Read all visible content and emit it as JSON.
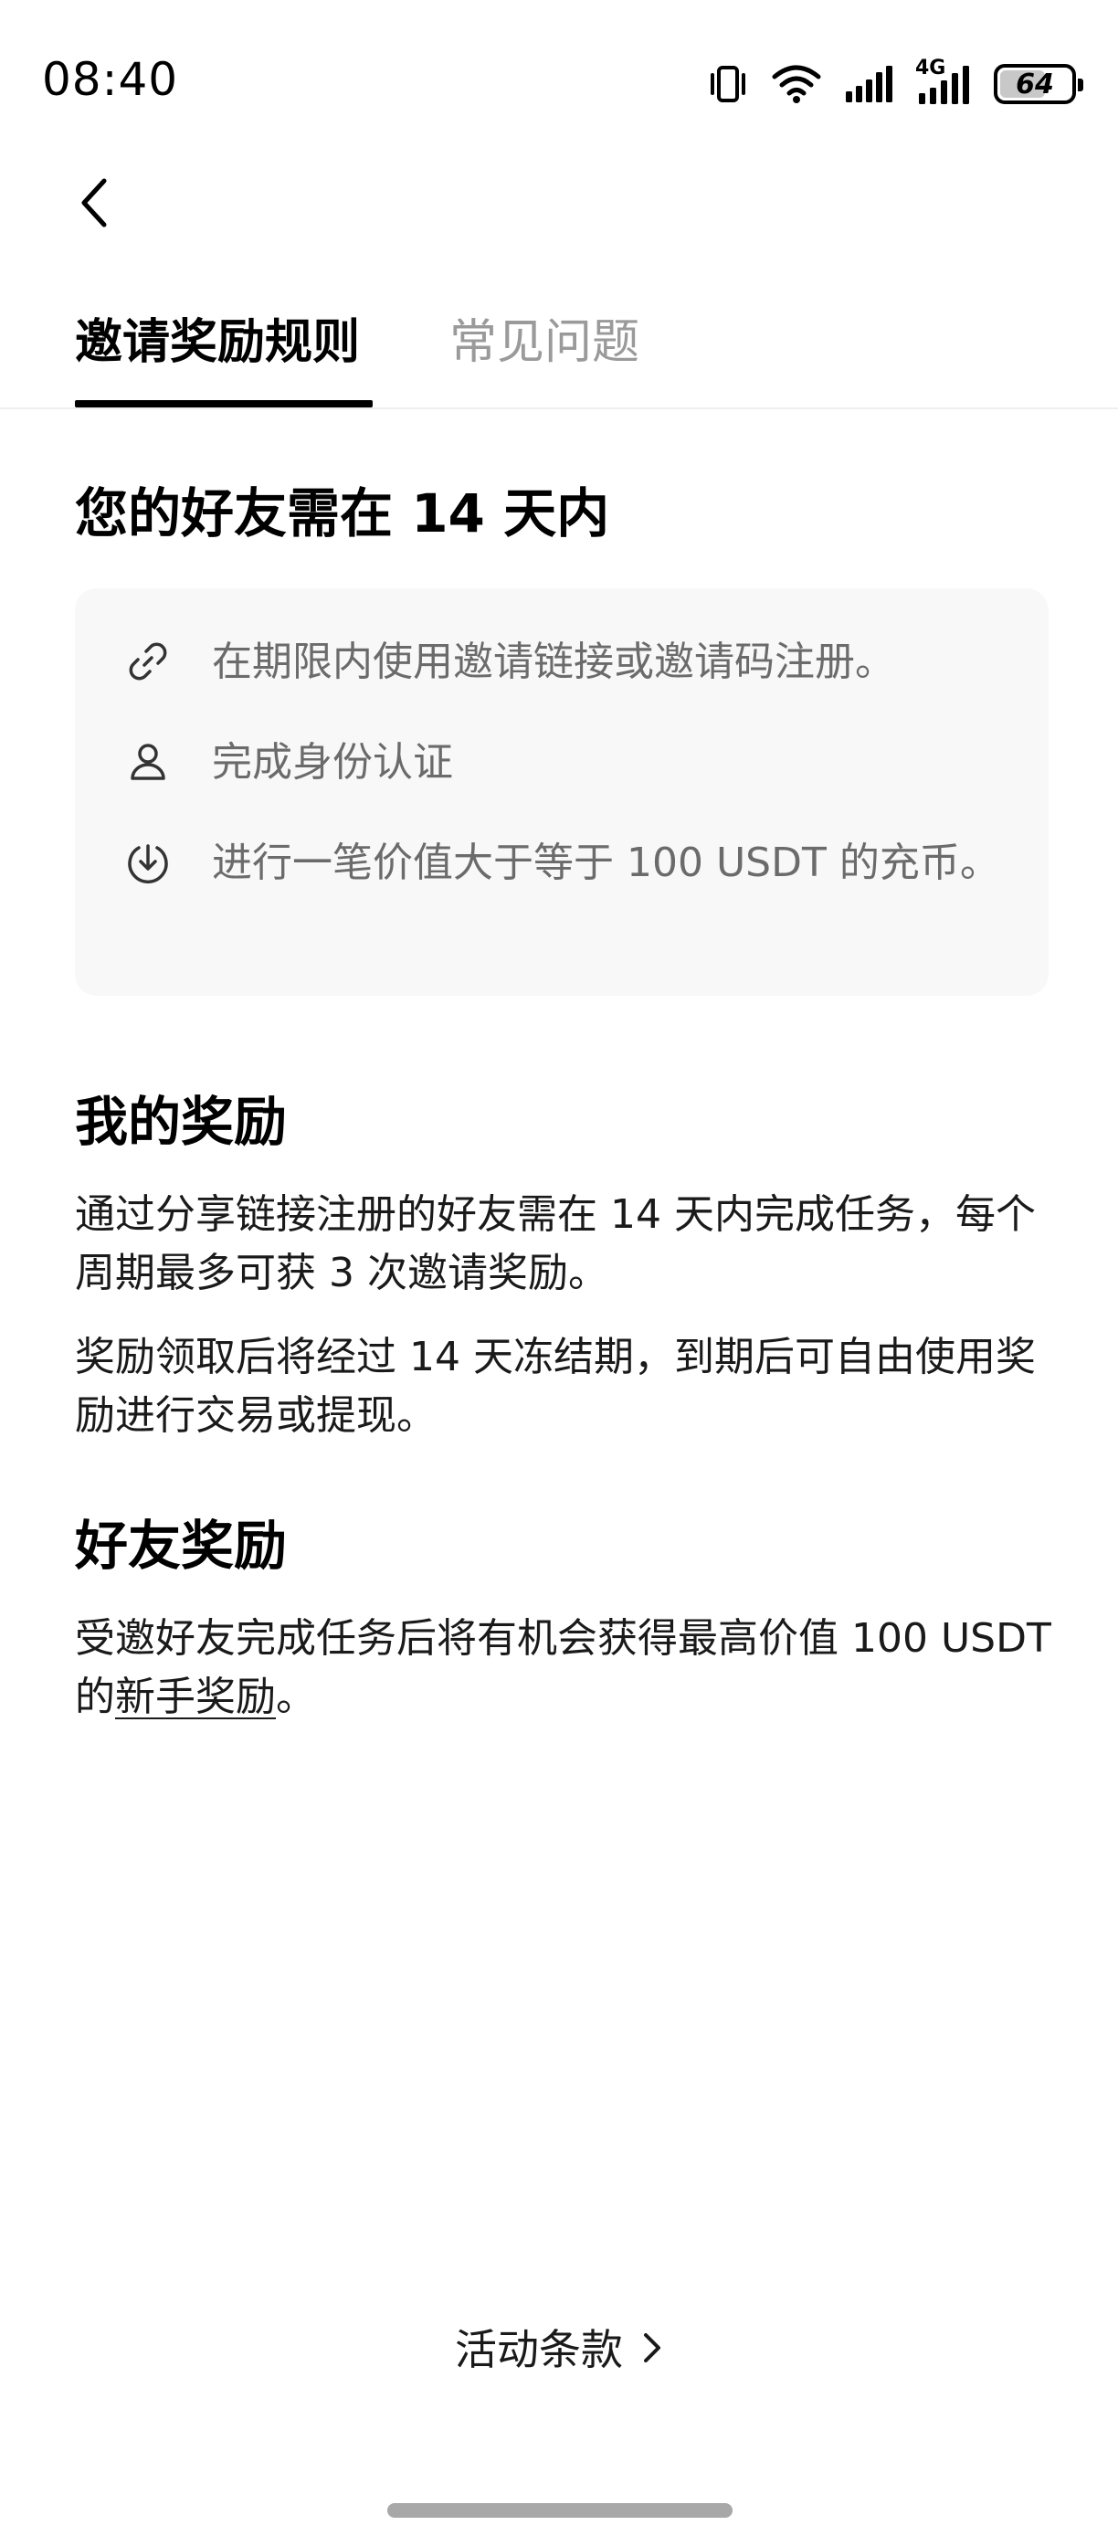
{
  "status_bar": {
    "time": "08:40",
    "signal_label": "4G",
    "battery_level": "64",
    "battery_fraction": 0.64
  },
  "icons": {
    "back": "chevron-left-icon",
    "vibrate": "vibrate-icon",
    "wifi": "wifi-icon",
    "signal": "cellular-signal-icon",
    "battery": "battery-icon",
    "link": "link-icon",
    "user": "user-icon",
    "deposit": "download-circle-icon",
    "terms_chevron": "chevron-right-icon"
  },
  "tabs": [
    {
      "label": "邀请奖励规则",
      "active": true
    },
    {
      "label": "常见问题",
      "active": false
    }
  ],
  "section_tasks": {
    "heading": "您的好友需在 14 天内",
    "items": [
      {
        "text": "在期限内使用邀请链接或邀请码注册。"
      },
      {
        "text": "完成身份认证"
      },
      {
        "text": "进行一笔价值大于等于 100 USDT 的充币。"
      }
    ]
  },
  "section_my_rewards": {
    "heading": "我的奖励",
    "paragraphs": [
      "通过分享链接注册的好友需在 14 天内完成任务，每个周期最多可获 3 次邀请奖励。",
      "奖励领取后将经过 14 天冻结期，到期后可自由使用奖励进行交易或提现。"
    ]
  },
  "section_friend_rewards": {
    "heading": "好友奖励",
    "text_before_link": "受邀好友完成任务后将有机会获得最高价值 100 USDT 的",
    "link_text": "新手奖励",
    "text_after_link": "。"
  },
  "footer": {
    "terms_label": "活动条款"
  },
  "colors": {
    "text_primary": "#000000",
    "text_secondary": "#6b6b6b",
    "tab_inactive": "#9a9a9a",
    "box_background": "#f8f8f8"
  }
}
